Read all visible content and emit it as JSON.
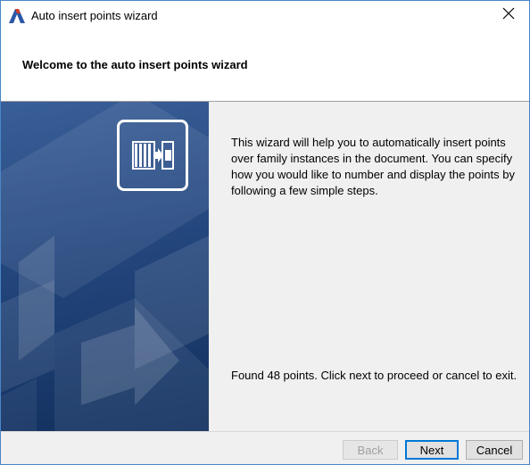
{
  "window": {
    "title": "Auto insert points wizard",
    "app_icon": "revit-logo-icon",
    "close_icon": "close-icon"
  },
  "header": {
    "title": "Welcome to the auto insert points wizard"
  },
  "banner": {
    "icon": "insert-points-icon"
  },
  "content": {
    "description": "This wizard will help you to automatically insert points over family instances in the document. You can specify how you would like to number and display the points by following a few simple steps.",
    "found_message": "Found 48 points. Click next to proceed or cancel to exit."
  },
  "footer": {
    "back_label": "Back",
    "next_label": "Next",
    "cancel_label": "Cancel"
  },
  "colors": {
    "banner_blue": "#23467d",
    "accent": "#0078d7"
  }
}
